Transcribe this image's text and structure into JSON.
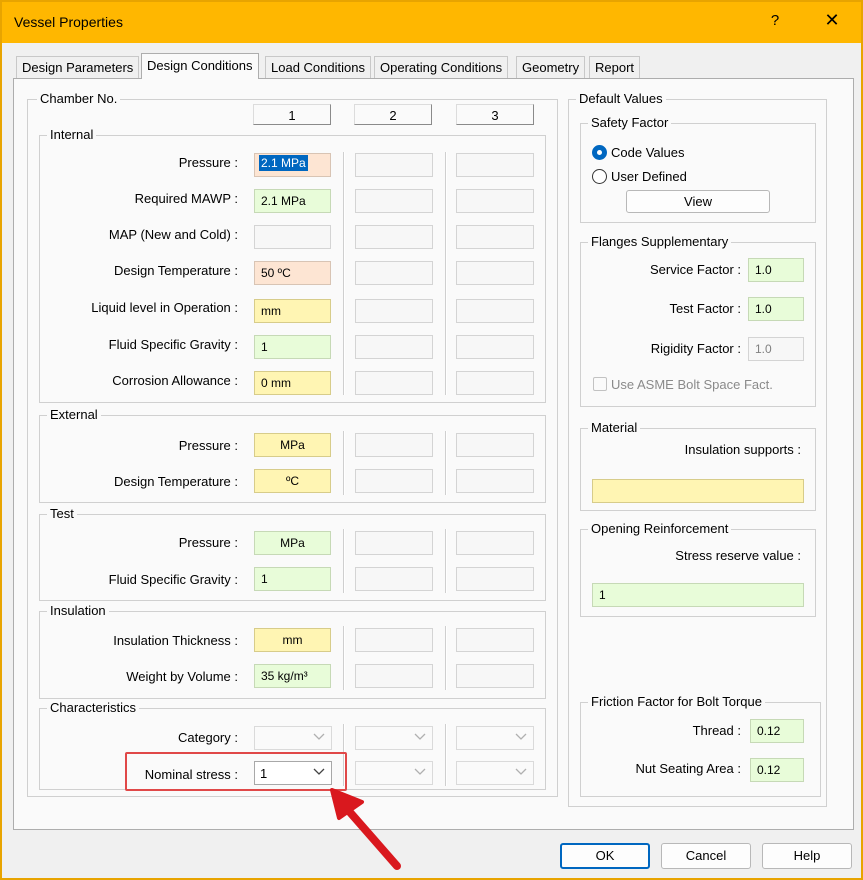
{
  "window": {
    "title": "Vessel Properties",
    "help_label": "?",
    "close_label": "✕"
  },
  "tabs": [
    "Design Parameters",
    "Design Conditions",
    "Load Conditions",
    "Operating Conditions",
    "Geometry",
    "Report"
  ],
  "active_tab": "Design Conditions",
  "chamber": {
    "label": "Chamber No.",
    "columns": [
      "1",
      "2",
      "3"
    ]
  },
  "internal": {
    "title": "Internal",
    "rows": [
      {
        "label": "Pressure :",
        "value": "2.1 MPa"
      },
      {
        "label": "Required MAWP :",
        "value": "2.1 MPa"
      },
      {
        "label": "MAP (New and Cold) :",
        "value": ""
      },
      {
        "label": "Design Temperature :",
        "value": "50 ºC"
      },
      {
        "label": "Liquid level in Operation :",
        "value": "mm"
      },
      {
        "label": "Fluid Specific Gravity :",
        "value": "1"
      },
      {
        "label": "Corrosion Allowance :",
        "value": "0 mm"
      }
    ]
  },
  "external": {
    "title": "External",
    "rows": [
      {
        "label": "Pressure :",
        "value": "MPa"
      },
      {
        "label": "Design Temperature :",
        "value": "ºC"
      }
    ]
  },
  "test": {
    "title": "Test",
    "rows": [
      {
        "label": "Pressure :",
        "value": "MPa"
      },
      {
        "label": "Fluid Specific Gravity :",
        "value": "1"
      }
    ]
  },
  "insulation": {
    "title": "Insulation",
    "rows": [
      {
        "label": "Insulation Thickness :",
        "value": "mm"
      },
      {
        "label": "Weight by Volume :",
        "value": "35 kg/m³"
      }
    ]
  },
  "characteristics": {
    "title": "Characteristics",
    "category_label": "Category :",
    "category_value": "",
    "nominal_stress_label": "Nominal stress :",
    "nominal_stress_value": "1"
  },
  "defaults": {
    "title": "Default Values",
    "safety_factor": {
      "title": "Safety Factor",
      "code_values_label": "Code Values",
      "user_defined_label": "User Defined",
      "selected": "Code Values",
      "view_label": "View"
    },
    "flanges": {
      "title": "Flanges Supplementary",
      "service_factor_label": "Service Factor :",
      "service_factor_value": "1.0",
      "test_factor_label": "Test Factor :",
      "test_factor_value": "1.0",
      "rigidity_factor_label": "Rigidity Factor :",
      "rigidity_factor_value": "1.0",
      "asme_label": "Use ASME Bolt Space Fact."
    },
    "material": {
      "title": "Material",
      "insulation_supports_label": "Insulation supports :",
      "insulation_supports_value": ""
    },
    "opening": {
      "title": "Opening Reinforcement",
      "stress_reserve_label": "Stress reserve value :",
      "stress_reserve_value": "1"
    },
    "friction": {
      "title": "Friction Factor for Bolt Torque",
      "thread_label": "Thread :",
      "thread_value": "0.12",
      "nut_label": "Nut Seating Area :",
      "nut_value": "0.12"
    }
  },
  "buttons": {
    "ok": "OK",
    "cancel": "Cancel",
    "help": "Help"
  },
  "colors": {
    "titlebar": "#ffb700",
    "green_field": "#e8fcd9",
    "yellow_field": "#fff5b3",
    "peach_field": "#fde5d3",
    "highlight": "#e04848",
    "arrow": "#d9181e",
    "accent": "#0067c0"
  }
}
